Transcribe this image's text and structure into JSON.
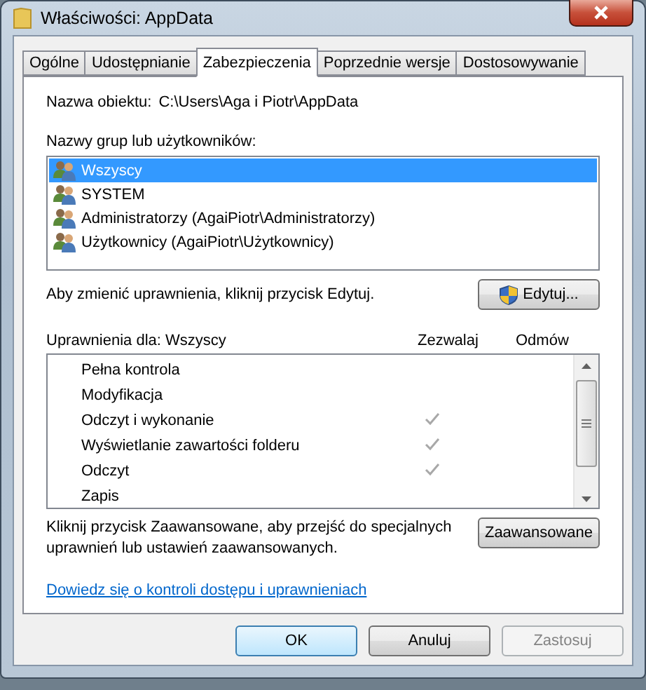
{
  "window": {
    "title": "Właściwości: AppData"
  },
  "tabs": [
    {
      "label": "Ogólne",
      "selected": false
    },
    {
      "label": "Udostępnianie",
      "selected": false
    },
    {
      "label": "Zabezpieczenia",
      "selected": true
    },
    {
      "label": "Poprzednie wersje",
      "selected": false
    },
    {
      "label": "Dostosowywanie",
      "selected": false
    }
  ],
  "object": {
    "label": "Nazwa obiektu:",
    "value": "C:\\Users\\Aga i Piotr\\AppData"
  },
  "groups": {
    "label": "Nazwy grup lub użytkowników:",
    "items": [
      {
        "name": "Wszyscy",
        "selected": true
      },
      {
        "name": "SYSTEM",
        "selected": false
      },
      {
        "name": "Administratorzy (AgaiPiotr\\Administratorzy)",
        "selected": false
      },
      {
        "name": "Użytkownicy (AgaiPiotr\\Użytkownicy)",
        "selected": false
      }
    ]
  },
  "edit_hint": "Aby zmienić uprawnienia, kliknij przycisk Edytuj.",
  "edit_button": "Edytuj...",
  "permissions": {
    "label": "Uprawnienia dla: Wszyscy",
    "allow_header": "Zezwalaj",
    "deny_header": "Odmów",
    "rows": [
      {
        "name": "Pełna kontrola",
        "allow": false,
        "deny": false
      },
      {
        "name": "Modyfikacja",
        "allow": false,
        "deny": false
      },
      {
        "name": "Odczyt i wykonanie",
        "allow": true,
        "deny": false
      },
      {
        "name": "Wyświetlanie zawartości folderu",
        "allow": true,
        "deny": false
      },
      {
        "name": "Odczyt",
        "allow": true,
        "deny": false
      },
      {
        "name": "Zapis",
        "allow": false,
        "deny": false
      }
    ]
  },
  "advanced_hint": "Kliknij przycisk Zaawansowane, aby przejść do specjalnych uprawnień lub ustawień zaawansowanych.",
  "advanced_button": "Zaawansowane",
  "link": "Dowiedz się o kontroli dostępu i uprawnieniach",
  "buttons": [
    {
      "label": "OK",
      "kind": "default",
      "disabled": false
    },
    {
      "label": "Anuluj",
      "kind": "normal",
      "disabled": false
    },
    {
      "label": "Zastosuj",
      "kind": "normal",
      "disabled": true
    }
  ]
}
